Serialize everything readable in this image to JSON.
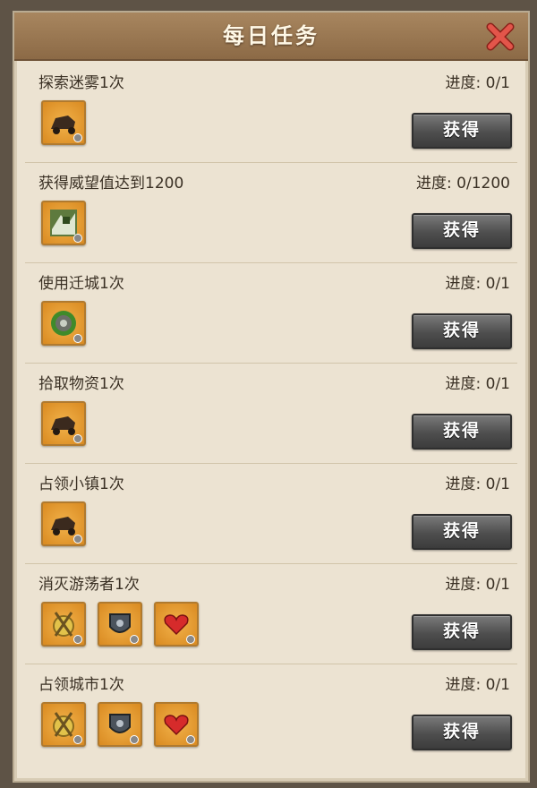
{
  "dialog": {
    "title": "每日任务",
    "close_icon": "close-x-icon"
  },
  "tasks": [
    {
      "name": "探索迷雾1次",
      "progress": "进度: 0/1",
      "button": "获得",
      "rewards": [
        "wagon-icon"
      ]
    },
    {
      "name": "获得威望值达到1200",
      "progress": "进度: 0/1200",
      "button": "获得",
      "rewards": [
        "prestige-icon"
      ]
    },
    {
      "name": "使用迁城1次",
      "progress": "进度: 0/1",
      "button": "获得",
      "rewards": [
        "relocate-icon"
      ]
    },
    {
      "name": "拾取物资1次",
      "progress": "进度: 0/1",
      "button": "获得",
      "rewards": [
        "wagon-icon"
      ]
    },
    {
      "name": "占领小镇1次",
      "progress": "进度: 0/1",
      "button": "获得",
      "rewards": [
        "wagon-icon"
      ]
    },
    {
      "name": "消灭游荡者1次",
      "progress": "进度: 0/1",
      "button": "获得",
      "rewards": [
        "medal-icon",
        "shield-icon",
        "heart-icon"
      ]
    },
    {
      "name": "占领城市1次",
      "progress": "进度: 0/1",
      "button": "获得",
      "rewards": [
        "medal-icon",
        "shield-icon",
        "heart-icon"
      ]
    }
  ],
  "colors": {
    "title_bar": "#9a7851",
    "panel": "#ece3d2",
    "button": "#4e4e4e",
    "close": "#d9453a"
  }
}
